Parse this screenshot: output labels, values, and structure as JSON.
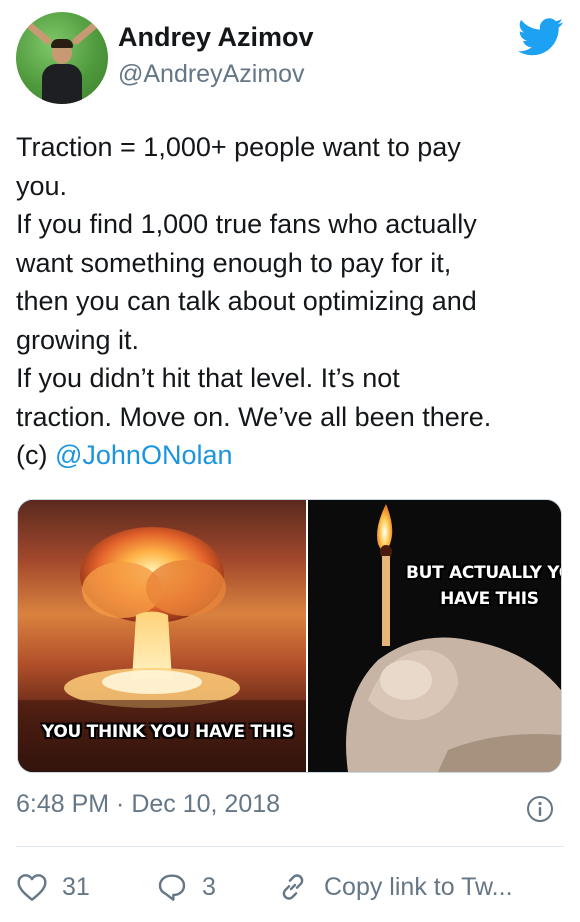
{
  "user": {
    "name": "Andrey Azimov",
    "handle": "@AndreyAzimov"
  },
  "tweet": {
    "lines": [
      "Traction = 1,000+ people want to pay",
      "you.",
      "If you find 1,000 true fans who actually",
      "want something enough to pay for it,",
      "then you can talk about optimizing and",
      "growing it.",
      "If you didn’t hit that level. It’s not",
      "traction. Move on. We’ve all been there."
    ],
    "credit_prefix": "(c) ",
    "mention": "@JohnONolan"
  },
  "media": {
    "left_caption": "YOU THINK YOU HAVE THIS",
    "right_caption_line1": "BUT ACTUALLY YO",
    "right_caption_line2": "HAVE THIS"
  },
  "meta": {
    "timestamp": "6:48 PM · Dec 10, 2018"
  },
  "actions": {
    "likes": "31",
    "replies": "3",
    "copy_label": "Copy link to Tw..."
  },
  "colors": {
    "twitter_blue": "#1da1f2",
    "link_blue": "#1b95e0",
    "muted_gray": "#657786"
  },
  "icons": [
    "twitter-bird-icon",
    "info-icon",
    "heart-icon",
    "reply-icon",
    "link-icon"
  ]
}
